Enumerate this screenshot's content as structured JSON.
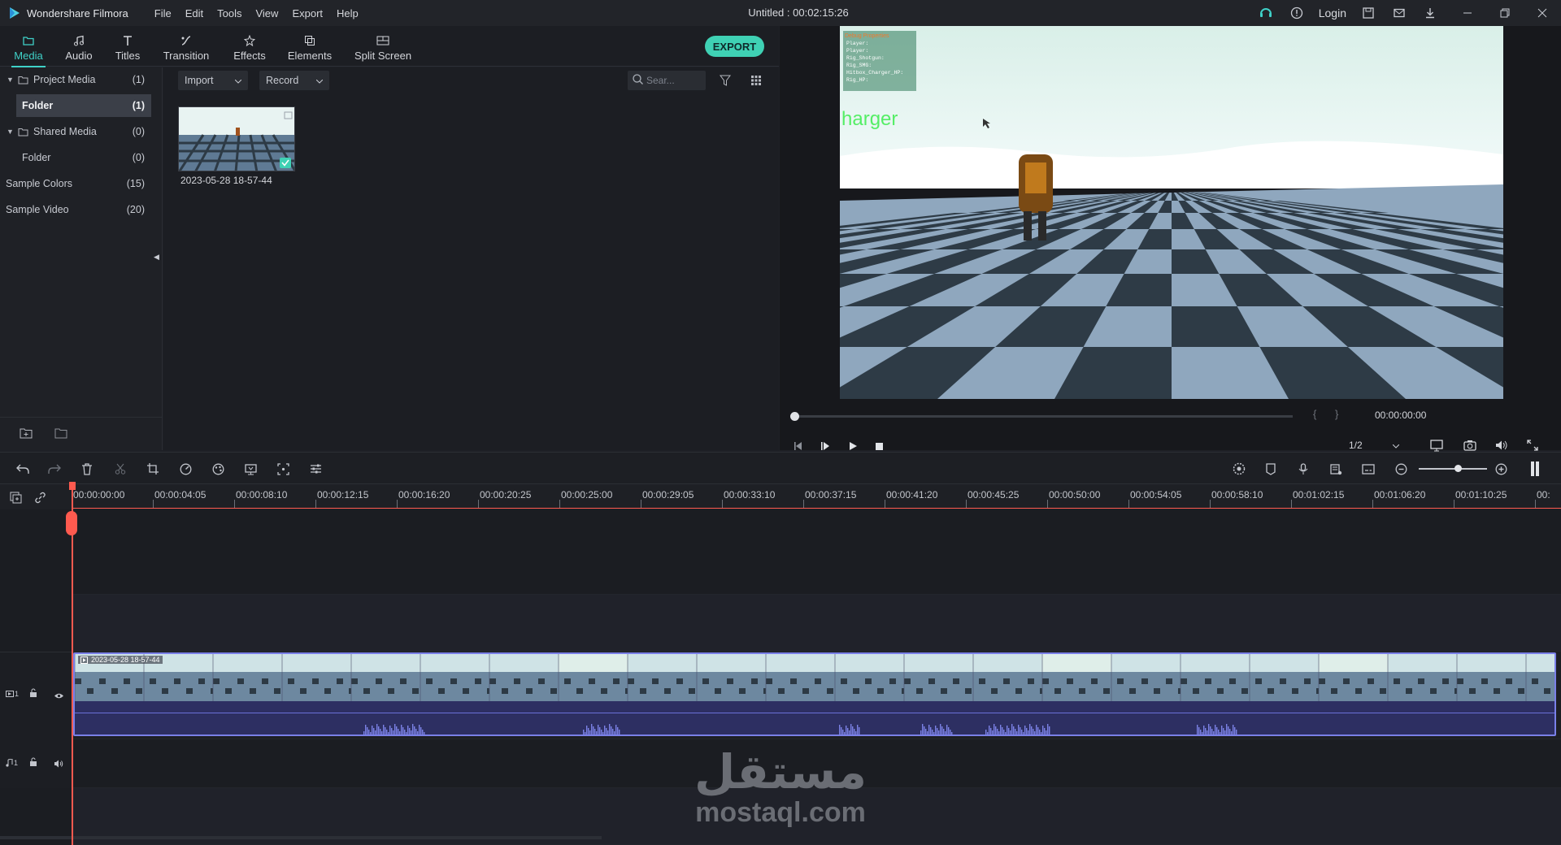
{
  "app": {
    "name": "Wondershare Filmora",
    "project_title": "Untitled : 00:02:15:26",
    "login": "Login"
  },
  "menu": [
    "File",
    "Edit",
    "Tools",
    "View",
    "Export",
    "Help"
  ],
  "tabs": [
    {
      "label": "Media",
      "icon": "folder-icon",
      "active": true
    },
    {
      "label": "Audio",
      "icon": "music-note-icon"
    },
    {
      "label": "Titles",
      "icon": "text-t-icon"
    },
    {
      "label": "Transition",
      "icon": "transition-icon"
    },
    {
      "label": "Effects",
      "icon": "effects-icon"
    },
    {
      "label": "Elements",
      "icon": "elements-icon"
    },
    {
      "label": "Split Screen",
      "icon": "split-screen-icon"
    }
  ],
  "export_label": "EXPORT",
  "library": [
    {
      "label": "Project Media",
      "count": "(1)",
      "type": "group"
    },
    {
      "label": "Folder",
      "count": "(1)",
      "type": "selected"
    },
    {
      "label": "Shared Media",
      "count": "(0)",
      "type": "group"
    },
    {
      "label": "Folder",
      "count": "(0)",
      "type": "child"
    },
    {
      "label": "Sample Colors",
      "count": "(15)",
      "type": "item"
    },
    {
      "label": "Sample Video",
      "count": "(20)",
      "type": "item"
    }
  ],
  "media_toolbar": {
    "import": "Import",
    "record": "Record",
    "search_placeholder": "Sear..."
  },
  "media_items": [
    {
      "name": "2023-05-28 18-57-44"
    }
  ],
  "preview": {
    "overlay_title": "Debug Properties",
    "overlay_lines": [
      "Player: ",
      "Player: ",
      "Rig_Shotgun: ",
      "Rig_SMG: ",
      "Hitbox_Charger_HP: ",
      "Rig_HP: "
    ],
    "world_text": "harger",
    "timecode": "00:00:00:00",
    "quality": "1/2",
    "progress": 0
  },
  "timeline": {
    "ticks": [
      "00:00:00:00",
      "00:00:04:05",
      "00:00:08:10",
      "00:00:12:15",
      "00:00:16:20",
      "00:00:20:25",
      "00:00:25:00",
      "00:00:29:05",
      "00:00:33:10",
      "00:00:37:15",
      "00:00:41:20",
      "00:00:45:25",
      "00:00:50:00",
      "00:00:54:05",
      "00:00:58:10",
      "00:01:02:15",
      "00:01:06:20",
      "00:01:10:25",
      "00:"
    ],
    "clip_name": "2023-05-28 18-57-44",
    "video_track": "1",
    "audio_track": "1"
  },
  "watermark": {
    "arabic": "مستقل",
    "latin": "mostaql.com"
  },
  "colors": {
    "accent": "#3fd1c8",
    "export": "#3fd1b4",
    "playhead": "#ff5a4f",
    "clip_border": "#7a80e8"
  }
}
